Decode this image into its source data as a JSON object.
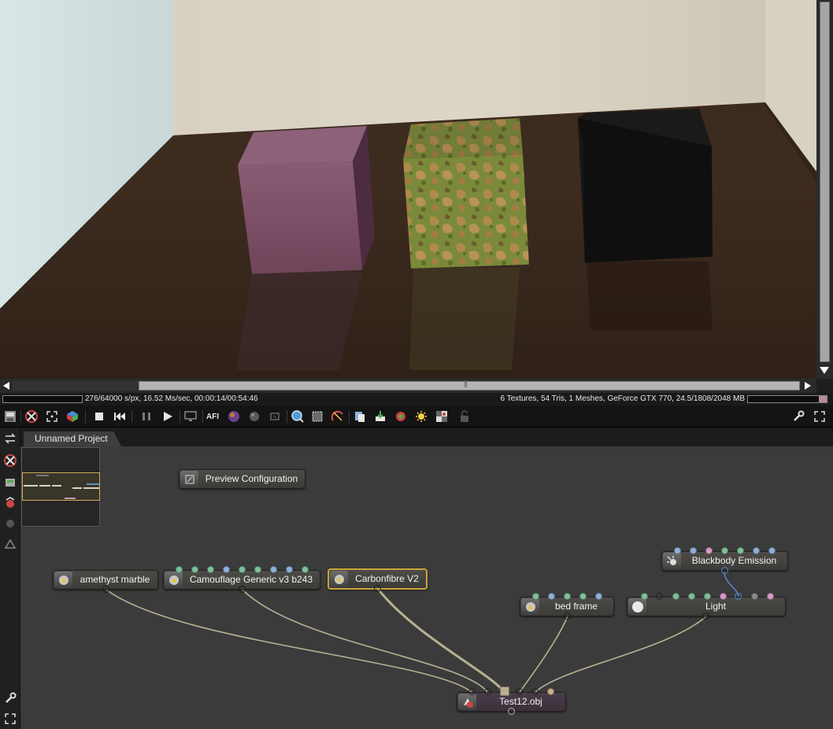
{
  "status": {
    "render_progress_text": "276/64000 s/px, 16.52 Ms/sec, 00:00:14/00:54:46",
    "scene_info_text": "6 Textures, 54 Tris, 1 Meshes, GeForce GTX 770, 24.5/1808/2048 MB"
  },
  "toolbar": {
    "icons": [
      "save-render-icon",
      "reset-camera-icon",
      "fullscreen-icon",
      "rgb-cube-icon",
      "stop-icon",
      "restart-icon",
      "pause-icon",
      "play-icon",
      "realtime-mode-icon",
      "afi-icon",
      "color-sphere-icon",
      "sphere-icon",
      "region-icon",
      "zoom-icon",
      "region-render-icon",
      "film-region-icon",
      "clipboard-icon",
      "export-icon",
      "color-pick-icon",
      "light-icon",
      "checker-icon",
      "lock-icon",
      "settings-wrench-icon",
      "maximize-icon"
    ],
    "afi_label": "AFI"
  },
  "graph": {
    "tab_label": "Unnamed Project",
    "nodes": {
      "preview": "Preview Configuration",
      "amethyst": "amethyst marble",
      "camouflage": "Camouflage Generic v3 b243",
      "carbon": "Carbonfibre V2",
      "bedframe": "bed frame",
      "light": "Light",
      "blackbody": "Blackbody Emission",
      "mesh": "Test12.obj"
    }
  },
  "colors": {
    "selection": "#c8a53a",
    "port_green": "#7fbf9a",
    "port_blue": "#8fb0d8",
    "port_pink": "#d69ac6",
    "wire": "#b9b092",
    "wire_blue": "#4f86c6"
  }
}
